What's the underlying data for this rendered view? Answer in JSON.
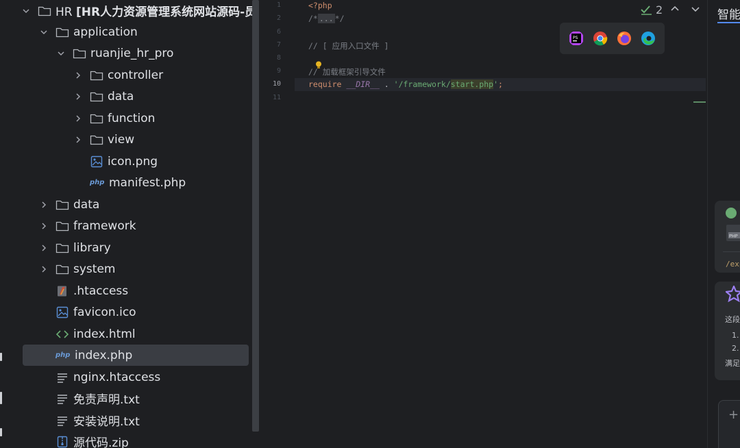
{
  "project_tree": {
    "root": {
      "prefix": "HR",
      "name": "[HR人力资源管理系统网站源码-员工管"
    },
    "items": [
      {
        "label": "application"
      },
      {
        "label": "ruanjie_hr_pro"
      },
      {
        "label": "controller"
      },
      {
        "label": "data"
      },
      {
        "label": "function"
      },
      {
        "label": "view"
      },
      {
        "label": "icon.png"
      },
      {
        "label": "manifest.php"
      },
      {
        "label": "data"
      },
      {
        "label": "framework"
      },
      {
        "label": "library"
      },
      {
        "label": "system"
      },
      {
        "label": ".htaccess"
      },
      {
        "label": "favicon.ico"
      },
      {
        "label": "index.html"
      },
      {
        "label": "index.php"
      },
      {
        "label": "nginx.htaccess"
      },
      {
        "label": "免责声明.txt"
      },
      {
        "label": "安装说明.txt"
      },
      {
        "label": "源代码.zip"
      }
    ],
    "php_badge": "php"
  },
  "editor": {
    "line_numbers": [
      "1",
      "2",
      "6",
      "7",
      "8",
      "9",
      "10",
      "11"
    ],
    "lines": {
      "open_tag": "<?php",
      "folded_open": "/*",
      "folded_dots": "...",
      "folded_close": "*/",
      "comment_entry": "// [ 应用入口文件 ]",
      "comment_loader": "// 加载框架引导文件",
      "require_kw": "require",
      "dir_const": "__DIR__",
      "concat": " . ",
      "path_a": "'/framework/",
      "path_b": "start.php",
      "path_c": "'",
      "semicolon": ";"
    },
    "inspections": {
      "count": "2"
    }
  },
  "ai_panel": {
    "title": "智能",
    "snippet_path": "/exp",
    "text_1": "这段",
    "list_1": "1.",
    "list_2": "2.",
    "text_2": "满足",
    "plus": "+"
  },
  "colors": {
    "accent": "#548af7",
    "selected_row": "#3a3d43"
  }
}
